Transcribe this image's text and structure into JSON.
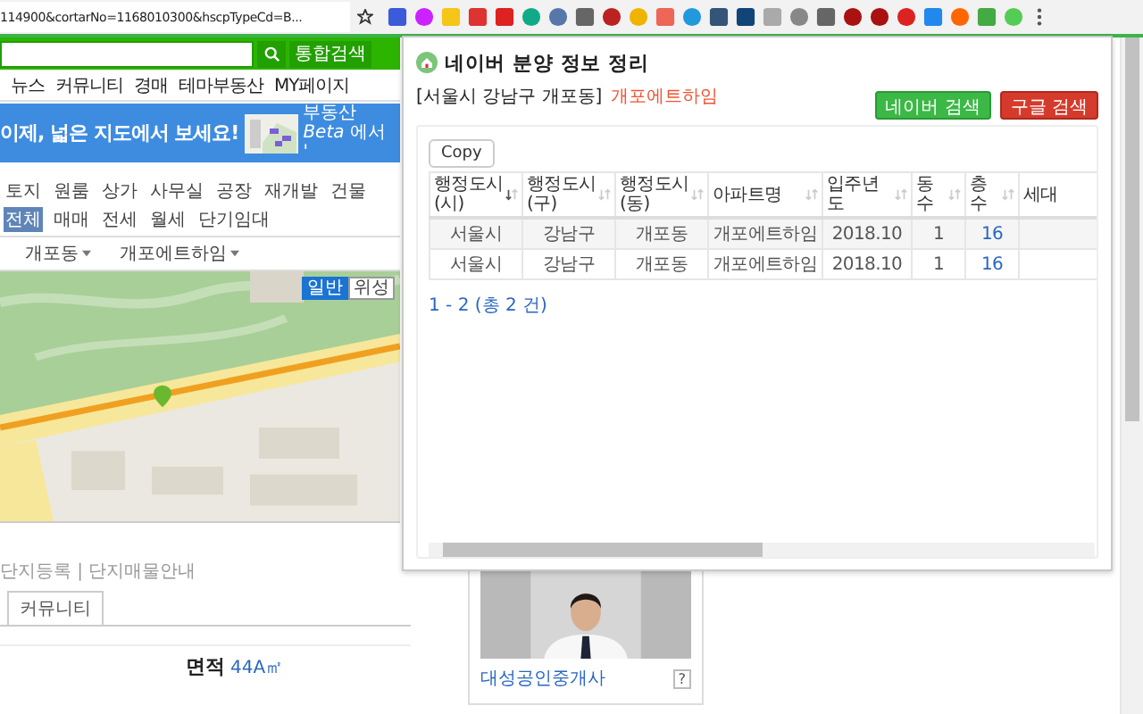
{
  "browser": {
    "url": "114900&cortarNo=1168010300&hscpTypeCd=B..."
  },
  "page": {
    "search": {
      "button": "통합검색"
    },
    "nav": [
      "뉴스",
      "커뮤니티",
      "경매",
      "테마부동산",
      "MY페이지"
    ],
    "banner": {
      "text": "이제, 넓은 지도에서 보세요!",
      "promo": "부동산 *Beta* 에서 '"
    },
    "filters": {
      "types": [
        "토지",
        "원룸",
        "상가",
        "사무실",
        "공장",
        "재개발",
        "건물"
      ],
      "deals": [
        {
          "label": "전체",
          "selected": true
        },
        {
          "label": "매매",
          "selected": false
        },
        {
          "label": "전세",
          "selected": false
        },
        {
          "label": "월세",
          "selected": false
        },
        {
          "label": "단기임대",
          "selected": false
        }
      ]
    },
    "breadcrumb": [
      "개포동",
      "개포에트하임"
    ],
    "map": {
      "kind": "picture",
      "view_toggle": [
        {
          "label": "일반",
          "selected": true
        },
        {
          "label": "위성",
          "selected": false
        }
      ]
    },
    "links": "단지등록 | 단지매물안내",
    "tab": "커뮤니티",
    "area": {
      "label": "면적",
      "value": "44A㎡"
    },
    "agent": {
      "name": "대성공인중개사",
      "help": "?"
    }
  },
  "popup": {
    "title": "네이버 분양 정보 정리",
    "location": "[서울시 강남구 개포동]",
    "complex": "개포에트하임",
    "buttons": [
      {
        "label": "네이버 검색",
        "kind": "naver"
      },
      {
        "label": "구글 검색",
        "kind": "google"
      }
    ],
    "copy": "Copy",
    "table": {
      "columns": [
        {
          "label": "행정도시(시)",
          "sorted": true
        },
        {
          "label": "행정도시(구)",
          "sorted": false
        },
        {
          "label": "행정도시(동)",
          "sorted": false
        },
        {
          "label": "아파트명",
          "sorted": false
        },
        {
          "label": "입주년도",
          "sorted": false
        },
        {
          "label": "동수",
          "sorted": false
        },
        {
          "label": "층수",
          "sorted": false
        },
        {
          "label": "세대"
        }
      ],
      "rows": [
        [
          "서울시",
          "강남구",
          "개포동",
          "개포에트하임",
          "2018.10",
          "1",
          "16"
        ],
        [
          "서울시",
          "강남구",
          "개포동",
          "개포에트하임",
          "2018.10",
          "1",
          "16"
        ]
      ]
    },
    "pagination": "1 - 2 (총 2 건)"
  }
}
